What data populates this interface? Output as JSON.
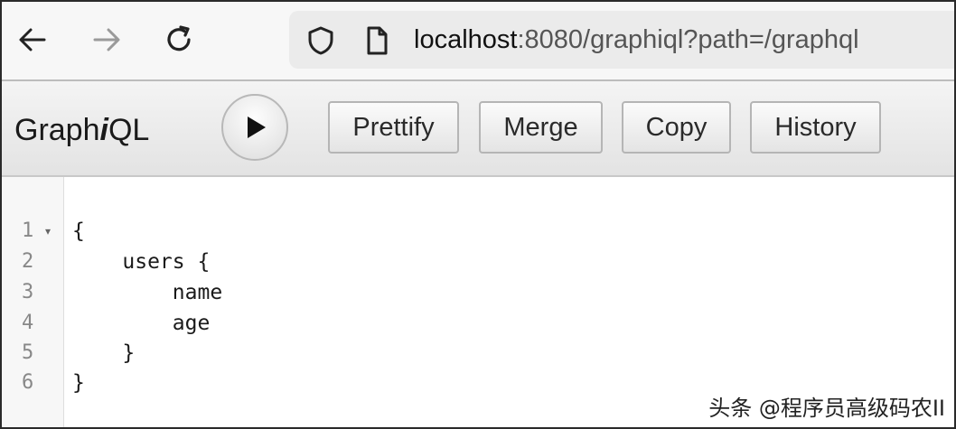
{
  "browser": {
    "url_host": "localhost",
    "url_rest": ":8080/graphiql?path=/graphql",
    "icons": [
      "back-arrow-icon",
      "forward-arrow-icon",
      "reload-icon",
      "shield-icon",
      "page-icon"
    ]
  },
  "toolbar": {
    "logo_prefix": "Graph",
    "logo_italic": "i",
    "logo_suffix": "QL",
    "run_icon": "play-icon",
    "buttons": {
      "prettify": "Prettify",
      "merge": "Merge",
      "copy": "Copy",
      "history": "History"
    }
  },
  "editor": {
    "line_numbers": [
      "1",
      "2",
      "3",
      "4",
      "5",
      "6"
    ],
    "fold_marker": "▾",
    "lines": [
      "{",
      "    users {",
      "        name",
      "        age",
      "    }",
      "}"
    ]
  },
  "watermark": "头条 @程序员高级码农II"
}
